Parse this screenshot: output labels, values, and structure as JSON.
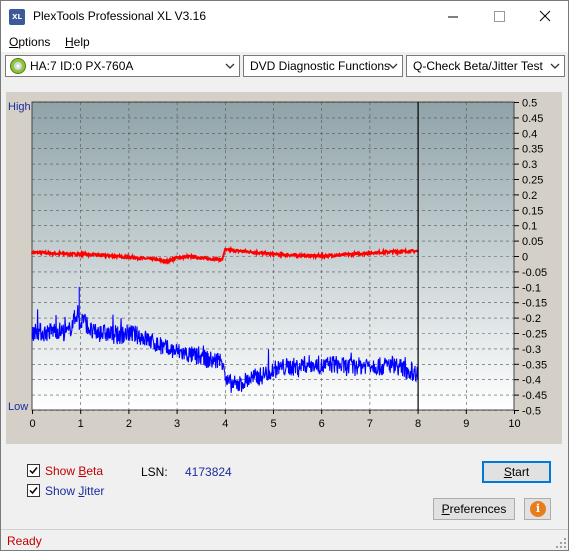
{
  "window": {
    "title": "PlexTools Professional XL V3.16",
    "icon_text": "XL"
  },
  "menu": {
    "items": [
      {
        "mnemonic": "O",
        "rest": "ptions"
      },
      {
        "mnemonic": "H",
        "rest": "elp"
      }
    ]
  },
  "toolbar": {
    "drive": "HA:7 ID:0  PX-760A",
    "function": "DVD Diagnostic Functions",
    "test": "Q-Check Beta/Jitter Test"
  },
  "chart_data": {
    "type": "line",
    "y_left_labels": {
      "top": "High",
      "bottom": "Low"
    },
    "x_ticks": [
      "0",
      "1",
      "2",
      "3",
      "4",
      "5",
      "6",
      "7",
      "8",
      "9",
      "10"
    ],
    "xlim": [
      0,
      10
    ],
    "y_right_ticks": [
      "0.5",
      "0.45",
      "0.4",
      "0.35",
      "0.3",
      "0.25",
      "0.2",
      "0.15",
      "0.1",
      "0.05",
      "0",
      "-0.05",
      "-0.1",
      "-0.15",
      "-0.2",
      "-0.25",
      "-0.3",
      "-0.35",
      "-0.4",
      "-0.45",
      "-0.5"
    ],
    "ylim": [
      -0.5,
      0.5
    ],
    "grid": true,
    "end_marker_x": 8,
    "series": [
      {
        "color": "#ff0000",
        "x": [
          0,
          0.5,
          1,
          1.5,
          2,
          2.5,
          2.8,
          3.0,
          3.3,
          3.6,
          3.95,
          4.0,
          4.5,
          5,
          5.5,
          6,
          6.5,
          7,
          7.5,
          8
        ],
        "values": [
          0.012,
          0.008,
          0.006,
          0.002,
          -0.004,
          -0.01,
          -0.018,
          -0.006,
          -0.002,
          -0.008,
          -0.012,
          0.02,
          0.014,
          0.006,
          0.002,
          0.0,
          0.004,
          0.01,
          0.014,
          0.016
        ]
      },
      {
        "color": "#0000ff",
        "x": [
          0,
          0.25,
          0.5,
          0.75,
          0.95,
          1.0,
          1.05,
          1.25,
          1.5,
          1.75,
          2.0,
          2.25,
          2.5,
          2.75,
          3.0,
          3.25,
          3.5,
          3.75,
          3.98,
          4.02,
          4.25,
          4.5,
          4.75,
          5.0,
          5.25,
          5.5,
          5.75,
          6.0,
          6.25,
          6.5,
          6.75,
          7.0,
          7.25,
          7.5,
          7.75,
          8.0
        ],
        "values": [
          -0.24,
          -0.25,
          -0.24,
          -0.25,
          -0.18,
          -0.23,
          -0.2,
          -0.25,
          -0.25,
          -0.26,
          -0.25,
          -0.26,
          -0.28,
          -0.3,
          -0.31,
          -0.32,
          -0.33,
          -0.34,
          -0.34,
          -0.41,
          -0.42,
          -0.4,
          -0.39,
          -0.37,
          -0.36,
          -0.36,
          -0.35,
          -0.36,
          -0.35,
          -0.36,
          -0.36,
          -0.35,
          -0.36,
          -0.35,
          -0.37,
          -0.38
        ]
      }
    ]
  },
  "controls": {
    "show_beta": {
      "mnemonic": "B",
      "before": "Show ",
      "after": "eta",
      "checked": true
    },
    "show_jitter": {
      "mnemonic": "J",
      "before": "Show ",
      "after": "itter",
      "checked": true
    },
    "lsn_label": "LSN:",
    "lsn_value": "4173824",
    "start_mnemonic": "S",
    "start_rest": "tart",
    "preferences_mnemonic": "P",
    "preferences_rest": "references",
    "info_glyph": "i"
  },
  "status": {
    "text": "Ready"
  },
  "colors": {
    "beta": "#ff0000",
    "jitter": "#0000ff",
    "plot_bg_top": "#8fa3a8",
    "plot_bg_bottom": "#ffffff",
    "accent": "#0078d7",
    "axis_text": "#1a2c9a"
  },
  "icons": {
    "app": "app-icon",
    "drive": "disc-icon",
    "minimize": "minimize-icon",
    "maximize": "maximize-icon",
    "close": "close-icon",
    "dropdown": "chevron-down-icon",
    "info": "info-icon",
    "resize": "resize-grip-icon"
  }
}
